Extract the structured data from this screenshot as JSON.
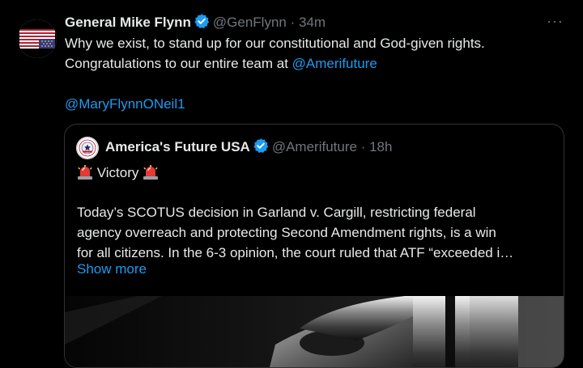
{
  "tweet": {
    "author_name": "General Mike Flynn",
    "handle": "@GenFlynn",
    "separator": "·",
    "time": "34m",
    "text_line1": "Why we exist, to stand up for our constitutional and God-given rights.",
    "text_line2_prefix": "Congratulations to our entire team at ",
    "mention1": "@Amerifuture",
    "mention2": "@MaryFlynnONeil1",
    "more_label": "···",
    "avatar_icon": "us-flag-upside-down-icon"
  },
  "quote": {
    "author_name": "America's Future USA",
    "handle": "@Amerifuture",
    "separator": "·",
    "time": "18h",
    "victory_label": "Victory",
    "text_lines": [
      "Today’s SCOTUS decision in Garland v. Cargill, restricting federal",
      "agency overreach and protecting Second Amendment rights, is a win",
      "for all citizens. In the 6-3 opinion, the court ruled that ATF “exceeded i…"
    ],
    "show_more_label": "Show more",
    "avatar_icon": "americas-future-seal-icon",
    "media_icon": "gavel-photo"
  },
  "colors": {
    "background": "#000000",
    "text": "#e7e9ea",
    "secondary_text": "#71767b",
    "link": "#1d9bf0",
    "verified": "#1d9bf0",
    "border": "#2f3336"
  }
}
